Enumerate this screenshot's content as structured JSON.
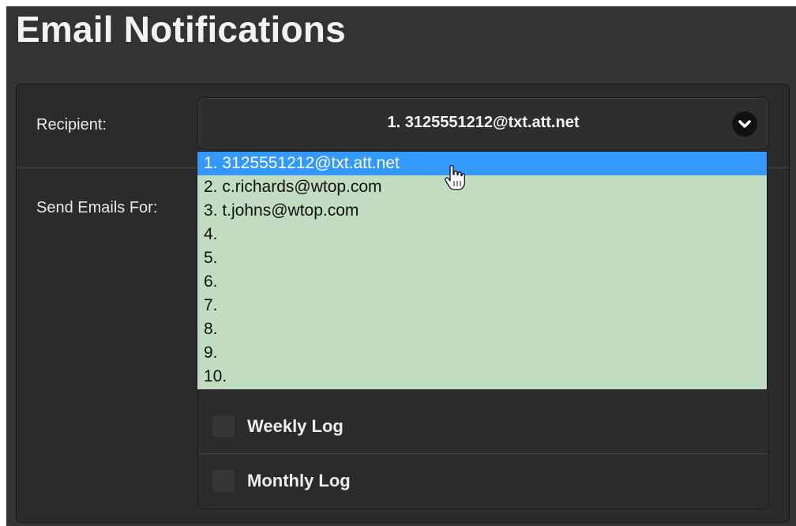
{
  "page": {
    "title": "Email Notifications"
  },
  "form": {
    "recipient_label": "Recipient:",
    "recipient_value": "1. 3125551212@txt.att.net",
    "send_emails_label": "Send Emails For:"
  },
  "recipient_options": [
    "1. 3125551212@txt.att.net",
    "2. c.richards@wtop.com",
    "3. t.johns@wtop.com",
    "4.",
    "5.",
    "6.",
    "7.",
    "8.",
    "9.",
    "10."
  ],
  "highlighted_option_index": 0,
  "send_options": [
    {
      "label": "Weekly Log",
      "checked": false
    },
    {
      "label": "Monthly Log",
      "checked": false
    }
  ],
  "icons": {
    "dropdown": "chevron-down-icon",
    "pointer": "hand-cursor-icon"
  },
  "colors": {
    "background": "#333333",
    "panel": "#2b2b2b",
    "dropdown_list_bg": "#c2dcc2",
    "highlight": "#3399ff"
  }
}
